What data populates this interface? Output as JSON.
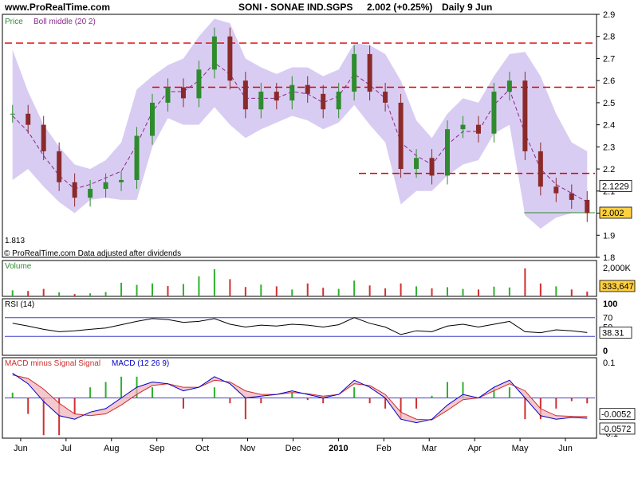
{
  "header": {
    "site": "www.ProRealTime.com",
    "title": "SONI - SONAE IND.SGPS",
    "quote": "2.002 (+0.25%)",
    "period": "Daily  9 Jun"
  },
  "colors": {
    "band": "#d9ccf2",
    "candle_up": "#2e8b2e",
    "candle_down": "#8b2a2a",
    "boll_middle": "#8a2a8a",
    "resistance": "#dd0000",
    "rsi_line": "#000000",
    "rsi_levels": "#4040c0",
    "macd_line": "#0000cc",
    "signal_line": "#cc3030",
    "macd_hist_pos": "#30b030",
    "macd_hist_neg": "#d03030",
    "vol_pos": "#30b030",
    "vol_neg": "#d03030",
    "highlight": "#ffd040"
  },
  "chart_data": [
    {
      "type": "candlestick",
      "legend": [
        "Price",
        "Boll middle (20 2)"
      ],
      "ylim": [
        1.8,
        2.9
      ],
      "yticks": [
        "2.9",
        "2.8",
        "2.7",
        "2.6",
        "2.5",
        "2.4",
        "2.3",
        "2.2",
        "2.1",
        "2.0",
        "1.9",
        "1.8"
      ],
      "x_months": [
        "Jun",
        "Jul",
        "Aug",
        "Sep",
        "Oct",
        "Nov",
        "Dec",
        "2010",
        "Feb",
        "Mar",
        "Apr",
        "May",
        "Jun"
      ],
      "period_start": "2009-06-01",
      "period_end": "2010-06-09",
      "close_series": [
        2.45,
        2.4,
        2.28,
        2.14,
        2.07,
        2.11,
        2.14,
        2.15,
        2.35,
        2.5,
        2.57,
        2.52,
        2.65,
        2.8,
        2.6,
        2.47,
        2.55,
        2.51,
        2.58,
        2.54,
        2.47,
        2.55,
        2.72,
        2.55,
        2.5,
        2.2,
        2.25,
        2.17,
        2.38,
        2.4,
        2.36,
        2.55,
        2.6,
        2.28,
        2.12,
        2.09,
        2.06,
        2.0
      ],
      "boll_middle": [
        2.44,
        2.37,
        2.26,
        2.17,
        2.11,
        2.13,
        2.16,
        2.19,
        2.31,
        2.46,
        2.55,
        2.55,
        2.6,
        2.68,
        2.63,
        2.52,
        2.52,
        2.52,
        2.55,
        2.54,
        2.5,
        2.53,
        2.63,
        2.58,
        2.52,
        2.32,
        2.26,
        2.22,
        2.31,
        2.37,
        2.37,
        2.49,
        2.56,
        2.36,
        2.2,
        2.13,
        2.09,
        2.05
      ],
      "boll_upper": [
        2.74,
        2.55,
        2.4,
        2.3,
        2.22,
        2.2,
        2.24,
        2.32,
        2.56,
        2.62,
        2.67,
        2.7,
        2.8,
        2.88,
        2.86,
        2.7,
        2.66,
        2.63,
        2.66,
        2.66,
        2.62,
        2.65,
        2.77,
        2.76,
        2.72,
        2.6,
        2.42,
        2.34,
        2.45,
        2.52,
        2.5,
        2.62,
        2.72,
        2.73,
        2.62,
        2.45,
        2.32,
        2.28
      ],
      "boll_lower": [
        2.15,
        2.2,
        2.12,
        2.05,
        2.0,
        2.06,
        2.07,
        2.06,
        2.06,
        2.3,
        2.43,
        2.4,
        2.4,
        2.48,
        2.4,
        2.34,
        2.38,
        2.41,
        2.44,
        2.42,
        2.38,
        2.41,
        2.49,
        2.4,
        2.32,
        2.04,
        2.1,
        2.1,
        2.17,
        2.22,
        2.24,
        2.36,
        2.4,
        1.99,
        1.93,
        1.98,
        2.0,
        2.0
      ],
      "resistance_lines": [
        {
          "value": 2.77,
          "from": 0.0,
          "to": 1.0
        },
        {
          "value": 2.57,
          "from": 0.25,
          "to": 1.0
        },
        {
          "value": 2.18,
          "from": 0.6,
          "to": 1.0
        }
      ],
      "support_line": {
        "value": 2.002,
        "from": 0.88,
        "to": 1.0
      },
      "price_tags": [
        {
          "label": "2.1229",
          "value": 2.1229,
          "highlight": false
        },
        {
          "label": "2.002",
          "value": 2.002,
          "highlight": true
        }
      ],
      "min_label": "1.813",
      "footnote": "© ProRealTime.com  Data adjusted after dividends"
    },
    {
      "type": "bar",
      "legend": "Volume",
      "ylim": [
        0,
        2500000
      ],
      "yticks": [
        "2,000K"
      ],
      "last_value": 333647,
      "last_label": "333,647",
      "values": [
        420000,
        380000,
        520000,
        280000,
        160000,
        210000,
        300000,
        950000,
        800000,
        900000,
        720000,
        860000,
        1400000,
        1900000,
        1200000,
        650000,
        820000,
        700000,
        480000,
        900000,
        600000,
        520000,
        1100000,
        760000,
        560000,
        900000,
        700000,
        560000,
        640000,
        520000,
        480000,
        680000,
        620000,
        1950000,
        900000,
        700000,
        480000,
        333647
      ],
      "up": [
        true,
        false,
        false,
        true,
        false,
        true,
        true,
        true,
        true,
        true,
        false,
        true,
        true,
        true,
        false,
        false,
        true,
        false,
        true,
        false,
        false,
        true,
        true,
        false,
        false,
        false,
        true,
        false,
        true,
        true,
        false,
        true,
        true,
        false,
        false,
        true,
        false,
        false
      ]
    },
    {
      "type": "line",
      "legend": "RSI (14)",
      "ylim": [
        0,
        100
      ],
      "yticks": [
        "100",
        "70",
        "50",
        "0"
      ],
      "levels": [
        70,
        30
      ],
      "last_label": "38.31",
      "values": [
        58,
        52,
        45,
        40,
        42,
        45,
        48,
        55,
        62,
        68,
        66,
        60,
        62,
        68,
        56,
        50,
        54,
        52,
        56,
        54,
        50,
        55,
        70,
        58,
        50,
        34,
        42,
        40,
        52,
        56,
        50,
        56,
        62,
        40,
        38,
        44,
        42,
        38.31
      ]
    },
    {
      "type": "line",
      "legend": [
        "MACD minus Signal Signal",
        "MACD (12 26 9)"
      ],
      "ylim": [
        -0.1,
        0.1
      ],
      "yticks": [
        "0.1",
        "-0.1"
      ],
      "tags": [
        "-0.0052",
        "-0.0572"
      ],
      "macd": [
        0.07,
        0.04,
        -0.01,
        -0.05,
        -0.06,
        -0.04,
        -0.03,
        0.0,
        0.03,
        0.045,
        0.04,
        0.02,
        0.03,
        0.06,
        0.04,
        0.0,
        0.005,
        0.01,
        0.02,
        0.01,
        0.0,
        0.01,
        0.05,
        0.03,
        0.0,
        -0.06,
        -0.07,
        -0.06,
        -0.02,
        0.01,
        0.0,
        0.03,
        0.05,
        0.0,
        -0.05,
        -0.06,
        -0.055,
        -0.0572
      ],
      "signal": [
        0.065,
        0.055,
        0.025,
        -0.015,
        -0.045,
        -0.05,
        -0.045,
        -0.02,
        0.01,
        0.035,
        0.04,
        0.03,
        0.03,
        0.05,
        0.045,
        0.02,
        0.01,
        0.01,
        0.015,
        0.012,
        0.005,
        0.01,
        0.04,
        0.035,
        0.01,
        -0.04,
        -0.06,
        -0.062,
        -0.035,
        -0.005,
        0.0,
        0.02,
        0.04,
        0.02,
        -0.03,
        -0.05,
        -0.052,
        -0.0521
      ]
    }
  ]
}
